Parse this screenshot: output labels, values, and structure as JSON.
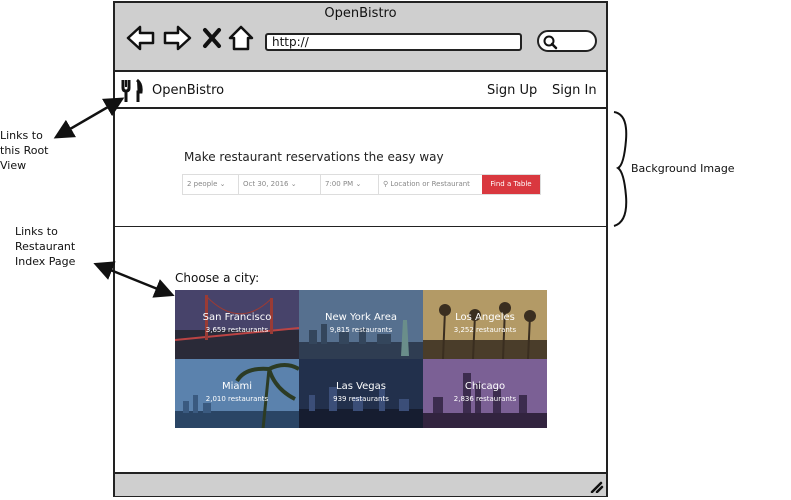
{
  "window": {
    "title": "OpenBistro",
    "url": "http://"
  },
  "app": {
    "brand": "OpenBistro",
    "sign_up": "Sign Up",
    "sign_in": "Sign In"
  },
  "hero": {
    "title": "Make restaurant reservations the easy way",
    "party": "2 people",
    "date": "Oct 30, 2016",
    "time": "7:00 PM",
    "search_placeholder": "Location or Restaurant",
    "button": "Find a Table"
  },
  "cities": {
    "heading": "Choose a city:",
    "items": [
      {
        "name": "San Francisco",
        "count": "3,659 restaurants",
        "color": "#3c3a52"
      },
      {
        "name": "New York Area",
        "count": "9,815 restaurants",
        "color": "#465a73"
      },
      {
        "name": "Los Angeles",
        "count": "3,252 restaurants",
        "color": "#9a8a61"
      },
      {
        "name": "Miami",
        "count": "2,010 restaurants",
        "color": "#4d6f95"
      },
      {
        "name": "Las Vegas",
        "count": "939 restaurants",
        "color": "#26324c"
      },
      {
        "name": "Chicago",
        "count": "2,836 restaurants",
        "color": "#6c5585"
      }
    ]
  },
  "annotations": {
    "root": [
      "Links to",
      "this Root",
      "View"
    ],
    "index": [
      "Links to",
      "Restaurant",
      "Index Page"
    ],
    "background": "Background Image"
  }
}
